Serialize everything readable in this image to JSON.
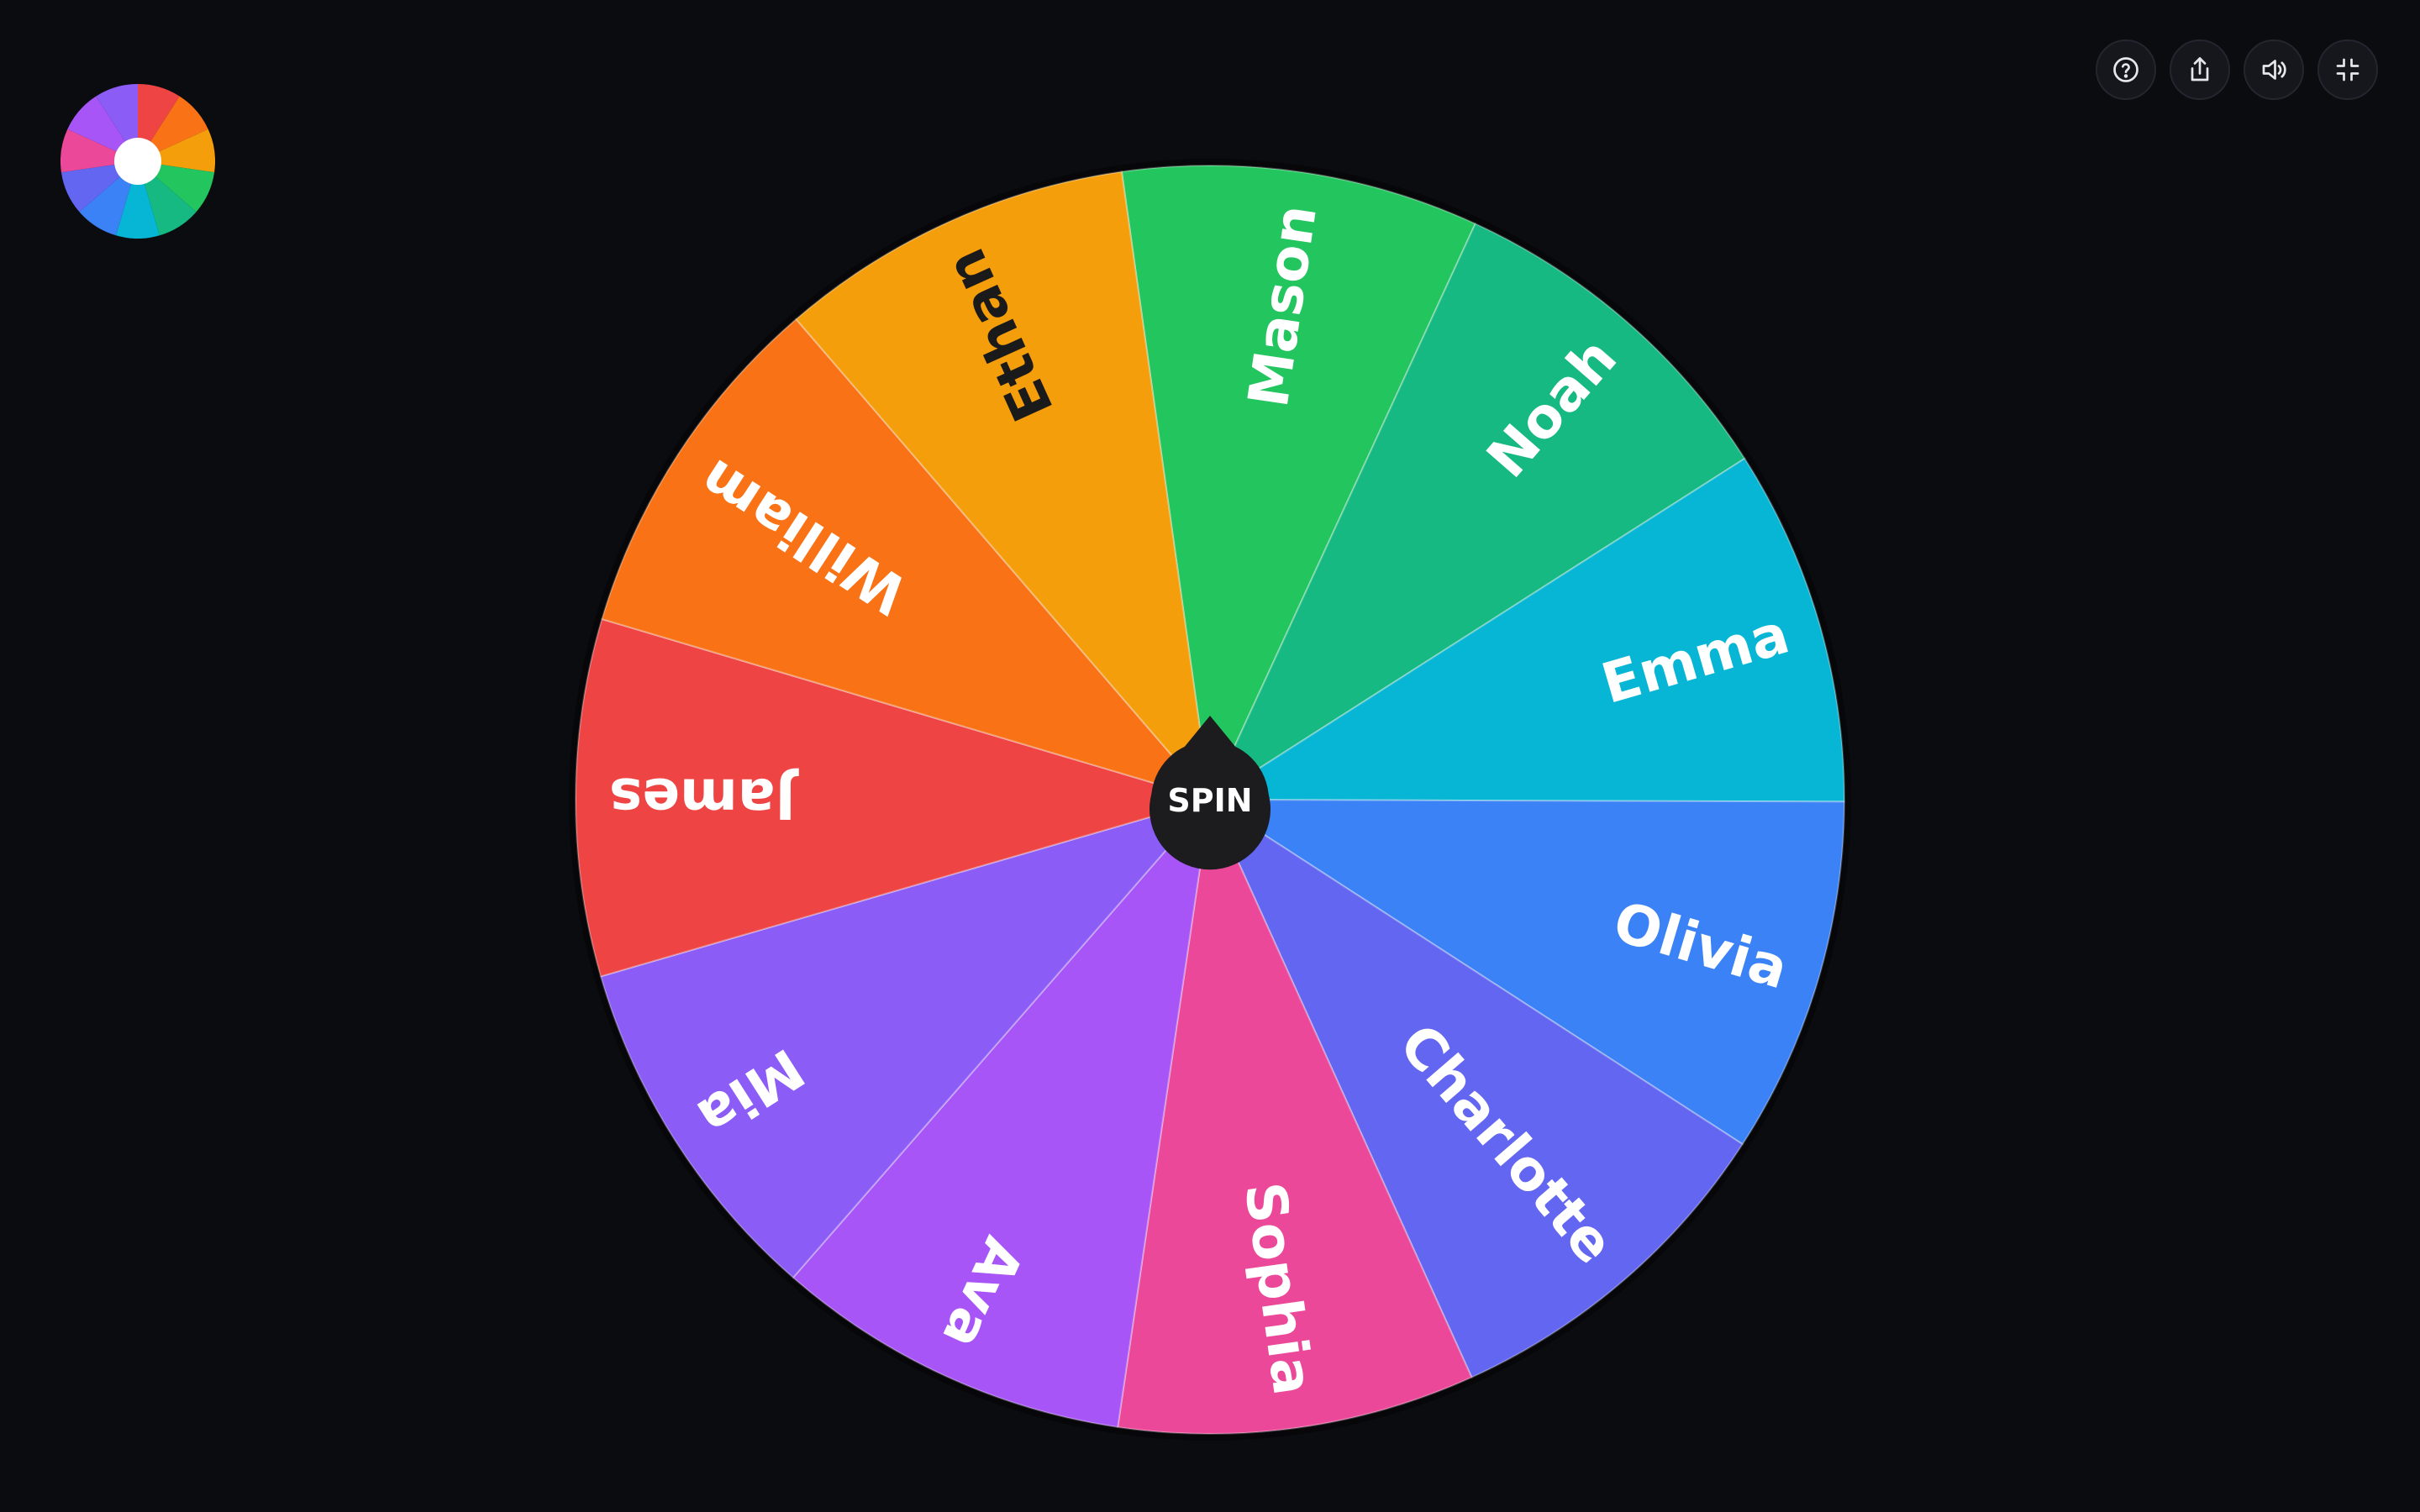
{
  "app": {
    "logo_icon": "color-wheel-logo-icon"
  },
  "toolbar": {
    "buttons": [
      {
        "icon": "help-icon"
      },
      {
        "icon": "share-icon"
      },
      {
        "icon": "sound-icon"
      },
      {
        "icon": "exit-fullscreen-icon"
      }
    ]
  },
  "wheel": {
    "spin_label": "SPIN",
    "rotation_deg": -98,
    "slices": [
      {
        "label": "Mason",
        "color": "#22c55e",
        "text_color": "#ffffff"
      },
      {
        "label": "Noah",
        "color": "#16b981",
        "text_color": "#ffffff"
      },
      {
        "label": "Emma",
        "color": "#06b6d4",
        "text_color": "#ffffff"
      },
      {
        "label": "Olivia",
        "color": "#3b82f6",
        "text_color": "#ffffff"
      },
      {
        "label": "Charlotte",
        "color": "#6366f1",
        "text_color": "#ffffff"
      },
      {
        "label": "Sophia",
        "color": "#ec4899",
        "text_color": "#ffffff"
      },
      {
        "label": "Ava",
        "color": "#a855f7",
        "text_color": "#ffffff"
      },
      {
        "label": "Mia",
        "color": "#8b5cf6",
        "text_color": "#ffffff"
      },
      {
        "label": "James",
        "color": "#ef4444",
        "text_color": "#ffffff"
      },
      {
        "label": "William",
        "color": "#f97316",
        "text_color": "#ffffff"
      },
      {
        "label": "Ethan",
        "color": "#f59e0b",
        "text_color": "#1a1a1a"
      }
    ]
  },
  "logo_colors": [
    "#ef4444",
    "#f97316",
    "#f59e0b",
    "#22c55e",
    "#16b981",
    "#06b6d4",
    "#3b82f6",
    "#6366f1",
    "#ec4899",
    "#a855f7",
    "#8b5cf6"
  ]
}
